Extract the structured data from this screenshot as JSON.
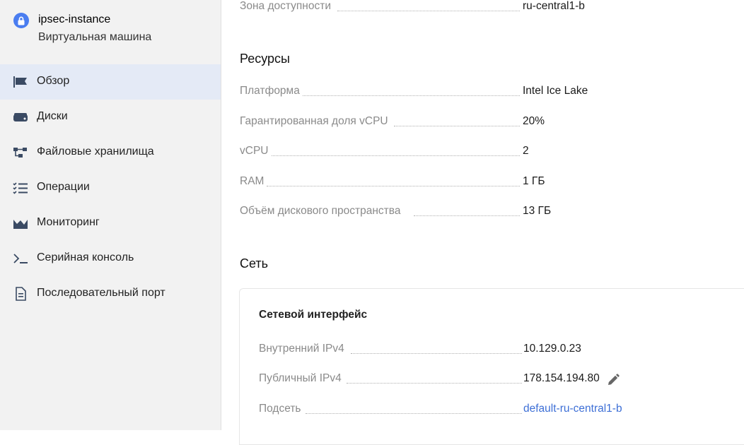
{
  "vm": {
    "name": "ipsec-instance",
    "type": "Виртуальная машина"
  },
  "nav": {
    "items": [
      {
        "label": "Обзор",
        "icon": "overview-flag-icon",
        "active": true
      },
      {
        "label": "Диски",
        "icon": "disk-icon"
      },
      {
        "label": "Файловые хранилища",
        "icon": "file-storage-icon"
      },
      {
        "label": "Операции",
        "icon": "operations-list-icon"
      },
      {
        "label": "Мониторинг",
        "icon": "monitoring-chart-icon"
      },
      {
        "label": "Серийная консоль",
        "icon": "terminal-icon"
      },
      {
        "label": "Последовательный порт",
        "icon": "document-icon"
      }
    ]
  },
  "zone": {
    "label": "Зона доступности",
    "value": "ru-central1-b"
  },
  "resources": {
    "title": "Ресурсы",
    "rows": [
      {
        "label": "Платформа",
        "value": "Intel Ice Lake"
      },
      {
        "label": "Гарантированная доля vCPU",
        "value": "20%"
      },
      {
        "label": "vCPU",
        "value": "2"
      },
      {
        "label": "RAM",
        "value": "1 ГБ"
      },
      {
        "label": "Объём дискового пространства",
        "value": "13 ГБ"
      }
    ]
  },
  "network": {
    "title": "Сеть",
    "card_title": "Сетевой интерфейс",
    "rows": [
      {
        "label": "Внутренний IPv4",
        "value": "10.129.0.23"
      },
      {
        "label": "Публичный IPv4",
        "value": "178.154.194.80"
      },
      {
        "label": "Подсеть",
        "value": "default-ru-central1-b"
      }
    ]
  },
  "colors": {
    "accent": "#4a7df0",
    "link": "#3d6fd6",
    "active_bg": "#e4eaf6"
  }
}
